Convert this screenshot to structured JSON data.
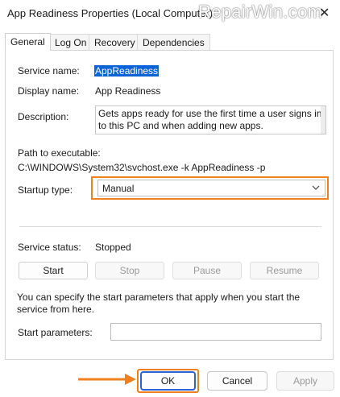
{
  "window": {
    "title": "App Readiness Properties (Local Computer)",
    "watermark": "RepairWin.com",
    "close_glyph": "✕"
  },
  "tabs": [
    {
      "label": "General",
      "active": true
    },
    {
      "label": "Log On",
      "active": false
    },
    {
      "label": "Recovery",
      "active": false
    },
    {
      "label": "Dependencies",
      "active": false
    }
  ],
  "general": {
    "service_name_label": "Service name:",
    "service_name_value": "AppReadiness",
    "display_name_label": "Display name:",
    "display_name_value": "App Readiness",
    "description_label": "Description:",
    "description_value": "Gets apps ready for use the first time a user signs in to this PC and when adding new apps.",
    "path_label": "Path to executable:",
    "path_value": "C:\\WINDOWS\\System32\\svchost.exe -k AppReadiness -p",
    "startup_type_label": "Startup type:",
    "startup_type_value": "Manual",
    "service_status_label": "Service status:",
    "service_status_value": "Stopped",
    "buttons": {
      "start": "Start",
      "stop": "Stop",
      "pause": "Pause",
      "resume": "Resume"
    },
    "help_text": "You can specify the start parameters that apply when you start the service from here.",
    "start_params_label": "Start parameters:",
    "start_params_value": ""
  },
  "footer": {
    "ok": "OK",
    "cancel": "Cancel",
    "apply": "Apply"
  },
  "colors": {
    "highlight_orange": "#f07f1e",
    "selection_blue": "#0a64d8",
    "primary_border": "#2b63d6"
  },
  "icons": {
    "dropdown": "chevron-down-icon",
    "pointer_arrow": "arrow-right-icon",
    "close": "close-icon"
  }
}
